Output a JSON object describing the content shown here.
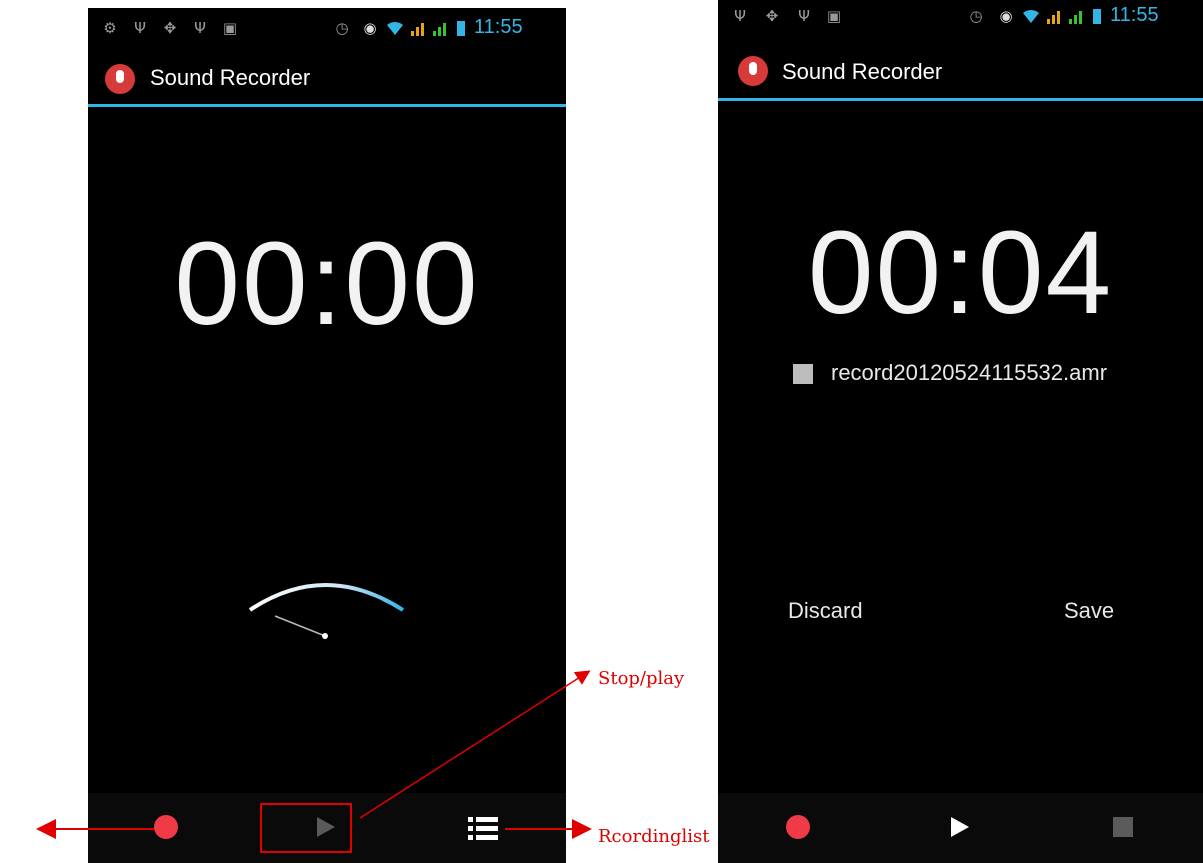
{
  "left_screen": {
    "status_bar": {
      "time": "11:55"
    },
    "action_bar": {
      "title": "Sound Recorder"
    },
    "timer": "00:00",
    "controls": {
      "record_icon": "record-icon",
      "play_icon": "play-icon",
      "list_icon": "list-icon"
    }
  },
  "right_screen": {
    "status_bar": {
      "time": "11:55"
    },
    "action_bar": {
      "title": "Sound Recorder"
    },
    "timer": "00:04",
    "file_name": "record20120524115532.amr",
    "discard_label": "Discard",
    "save_label": "Save",
    "controls": {
      "record_icon": "record-icon",
      "play_icon": "play-icon",
      "stop_icon": "stop-icon"
    }
  },
  "annotations": {
    "stop_play": "Stop/play",
    "recording_list": "Rcordinglist"
  },
  "colors": {
    "accent": "#33b5e5",
    "record": "#f03a47",
    "annotation": "#e00000"
  }
}
